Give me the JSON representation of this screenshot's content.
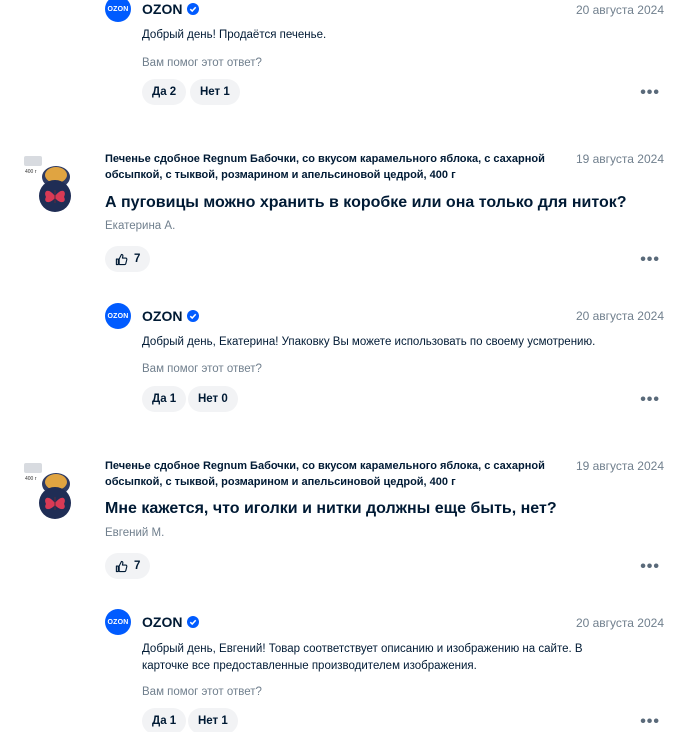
{
  "answers": [
    {
      "brand": "OZON",
      "logo_text": "OZON",
      "date": "20 августа 2024",
      "text": "Добрый день! Продаётся печенье.",
      "helpful_question": "Вам помог этот ответ?",
      "yes_label": "Да 2",
      "no_label": "Нет 1",
      "more": "•••"
    },
    {
      "brand": "OZON",
      "logo_text": "OZON",
      "date": "20 августа 2024",
      "text": "Добрый день, Екатерина! Упаковку Вы можете использовать по своему усмотрению.",
      "helpful_question": "Вам помог этот ответ?",
      "yes_label": "Да 1",
      "no_label": "Нет 0",
      "more": "•••"
    },
    {
      "brand": "OZON",
      "logo_text": "OZON",
      "date": "20 августа 2024",
      "text": "Добрый день, Евгений! Товар соответствует описанию и изображению на сайте. В карточке все предоставленные производителем изображения.",
      "helpful_question": "Вам помог этот ответ?",
      "yes_label": "Да 1",
      "no_label": "Нет 1",
      "more": "•••"
    }
  ],
  "questions": [
    {
      "product": "Печенье сдобное Regnum Бабочки, со вкусом карамельного яблока, с сахарной обсыпкой, с тыквой, розмарином и апельсиновой цедрой, 400 г",
      "date": "19 августа 2024",
      "text": "А пуговицы можно хранить в коробке или она только для ниток?",
      "author": "Екатерина А.",
      "likes": "7",
      "thumb_weight": "400 г",
      "more": "•••"
    },
    {
      "product": "Печенье сдобное Regnum Бабочки, со вкусом карамельного яблока, с сахарной обсыпкой, с тыквой, розмарином и апельсиновой цедрой, 400 г",
      "date": "19 августа 2024",
      "text": "Мне кажется, что иголки и нитки должны еще быть, нет?",
      "author": "Евгений М.",
      "likes": "7",
      "thumb_weight": "400 г",
      "more": "•••"
    }
  ],
  "colors": {
    "ozon_blue": "#005bff",
    "text": "#001a34",
    "muted": "#707f8d",
    "button_bg": "#f2f3f5"
  }
}
